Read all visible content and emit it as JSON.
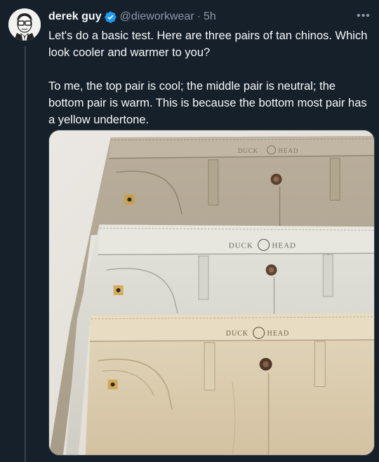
{
  "tweet": {
    "author_name": "derek guy",
    "handle": "@dieworkwear",
    "separator": "·",
    "time": "5h",
    "more_label": "•••",
    "paragraphs": [
      "Let's do a basic test. Here are three pairs of tan chinos. Which look cooler and warmer to you?",
      "To me, the top pair is cool; the middle pair is neutral; the bottom pair is warm. This is because the bottom most pair has a yellow undertone."
    ]
  },
  "media": {
    "brand_left": "DUCK",
    "brand_right": "HEAD",
    "pants": [
      {
        "name": "top-pair",
        "color": "#b3a894"
      },
      {
        "name": "middle-pair",
        "color": "#d8d7cf"
      },
      {
        "name": "bottom-pair",
        "color": "#dccdb0"
      }
    ]
  },
  "colors": {
    "background": "#15202b",
    "text_primary": "#f7f9f9",
    "text_secondary": "#8b98a5",
    "verified_blue": "#1d9bf0",
    "thread_line": "#38444d"
  },
  "icons": {
    "verified": "verified-badge-icon",
    "more": "more-options-icon",
    "avatar": "avatar-illustration"
  }
}
